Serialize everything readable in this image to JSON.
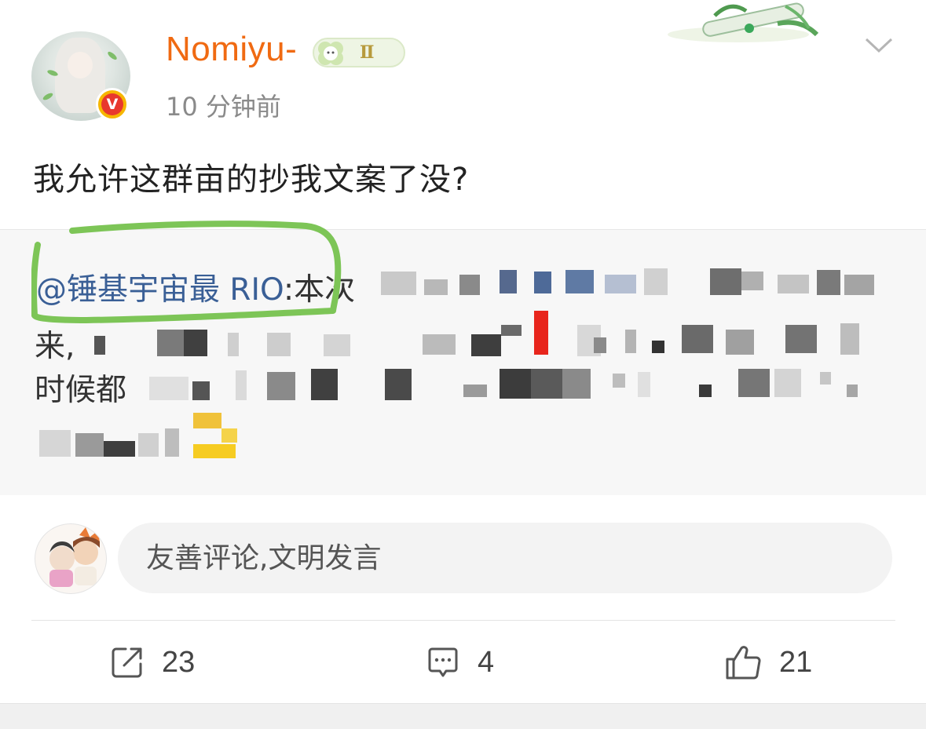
{
  "post": {
    "author": {
      "name": "Nomiyu-",
      "verified_badge": "V",
      "level_badge": "Ⅱ",
      "name_color": "#f06a12"
    },
    "timestamp": "10 分钟前",
    "text": "我允许这群亩的抄我文案了没?",
    "more_icon": "chevron-down-icon"
  },
  "repost": {
    "mention": "@锤基宇宙最 RIO",
    "visible_text": ":本次",
    "line2_start": "来,",
    "line3_start": "时候都",
    "mention_color": "#3a5f96",
    "annotation_color": "#7dc557"
  },
  "comment_bar": {
    "placeholder": "友善评论,文明发言"
  },
  "actions": {
    "repost": {
      "icon": "share-icon",
      "count": "23"
    },
    "comment": {
      "icon": "comment-icon",
      "count": "4"
    },
    "like": {
      "icon": "thumbs-up-icon",
      "count": "21"
    }
  }
}
